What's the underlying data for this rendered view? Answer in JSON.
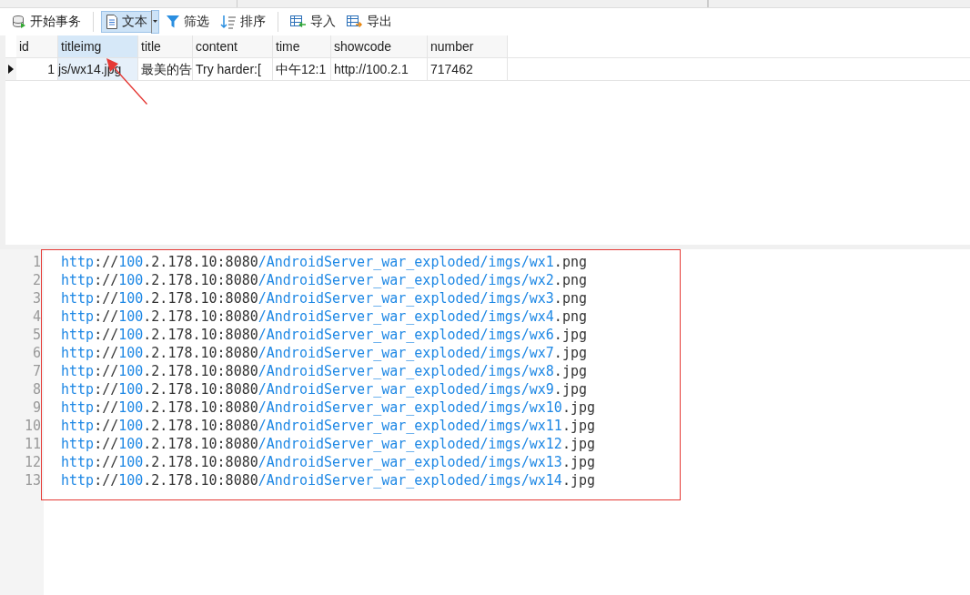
{
  "toolbar": [
    {
      "kind": "begin",
      "label": "开始事务",
      "selected": false
    },
    {
      "kind": "text",
      "label": "文本",
      "selected": true
    },
    {
      "kind": "filter",
      "label": "筛选",
      "selected": false
    },
    {
      "kind": "sort",
      "label": "排序",
      "selected": false
    },
    {
      "kind": "import",
      "label": "导入",
      "selected": false
    },
    {
      "kind": "export",
      "label": "导出",
      "selected": false
    }
  ],
  "table": {
    "columns": [
      {
        "label": "id",
        "selected": false
      },
      {
        "label": "titleimg",
        "selected": true
      },
      {
        "label": "title",
        "selected": false
      },
      {
        "label": "content",
        "selected": false
      },
      {
        "label": "time",
        "selected": false
      },
      {
        "label": "showcode",
        "selected": false
      },
      {
        "label": "number",
        "selected": false
      }
    ],
    "rows": [
      {
        "current": true,
        "cells": [
          "1",
          "js/wx14.jpg",
          "最美的告",
          "Try harder:[",
          "中午12:1",
          "http://100.2.1",
          "717462"
        ]
      }
    ]
  },
  "editor": {
    "lines": [
      {
        "number": "1",
        "segments": [
          "http",
          "://",
          "100",
          ".2.178.10:8080",
          "/AndroidServer_war_exploded/imgs/wx1",
          ".png"
        ]
      },
      {
        "number": "2",
        "segments": [
          "http",
          "://",
          "100",
          ".2.178.10:8080",
          "/AndroidServer_war_exploded/imgs/wx2",
          ".png"
        ]
      },
      {
        "number": "3",
        "segments": [
          "http",
          "://",
          "100",
          ".2.178.10:8080",
          "/AndroidServer_war_exploded/imgs/wx3",
          ".png"
        ]
      },
      {
        "number": "4",
        "segments": [
          "http",
          "://",
          "100",
          ".2.178.10:8080",
          "/AndroidServer_war_exploded/imgs/wx4",
          ".png"
        ]
      },
      {
        "number": "5",
        "segments": [
          "http",
          "://",
          "100",
          ".2.178.10:8080",
          "/AndroidServer_war_exploded/imgs/wx6",
          ".jpg"
        ]
      },
      {
        "number": "6",
        "segments": [
          "http",
          "://",
          "100",
          ".2.178.10:8080",
          "/AndroidServer_war_exploded/imgs/wx7",
          ".jpg"
        ]
      },
      {
        "number": "7",
        "segments": [
          "http",
          "://",
          "100",
          ".2.178.10:8080",
          "/AndroidServer_war_exploded/imgs/wx8",
          ".jpg"
        ]
      },
      {
        "number": "8",
        "segments": [
          "http",
          "://",
          "100",
          ".2.178.10:8080",
          "/AndroidServer_war_exploded/imgs/wx9",
          ".jpg"
        ]
      },
      {
        "number": "9",
        "segments": [
          "http",
          "://",
          "100",
          ".2.178.10:8080",
          "/AndroidServer_war_exploded/imgs/wx10",
          ".jpg"
        ]
      },
      {
        "number": "10",
        "segments": [
          "http",
          "://",
          "100",
          ".2.178.10:8080",
          "/AndroidServer_war_exploded/imgs/wx11",
          ".jpg"
        ]
      },
      {
        "number": "11",
        "segments": [
          "http",
          "://",
          "100",
          ".2.178.10:8080",
          "/AndroidServer_war_exploded/imgs/wx12",
          ".jpg"
        ]
      },
      {
        "number": "12",
        "segments": [
          "http",
          "://",
          "100",
          ".2.178.10:8080",
          "/AndroidServer_war_exploded/imgs/wx13",
          ".jpg"
        ]
      },
      {
        "number": "13",
        "segments": [
          "http",
          "://",
          "100",
          ".2.178.10:8080",
          "/AndroidServer_war_exploded/imgs/wx14",
          ".jpg"
        ]
      }
    ]
  },
  "annotation_arrow": true,
  "highlight_box": true
}
